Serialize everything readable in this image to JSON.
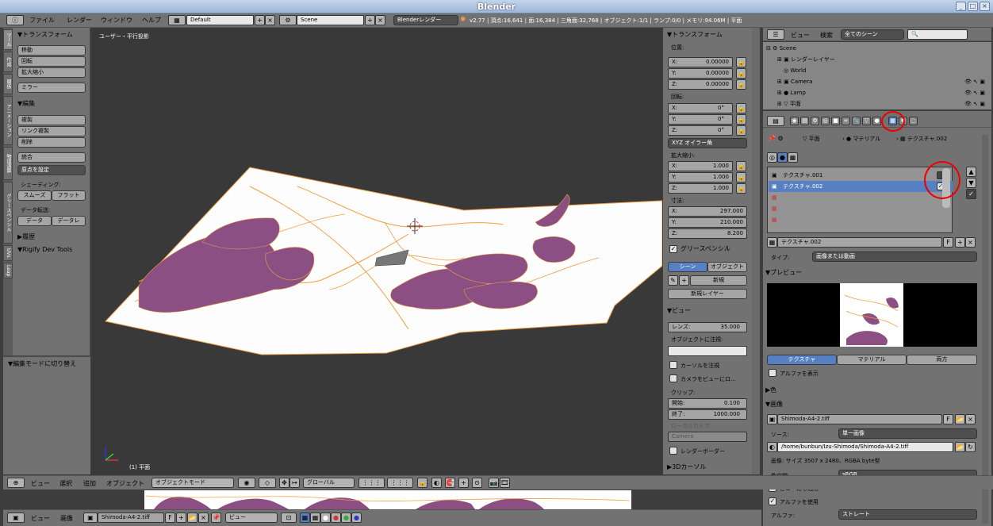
{
  "window": {
    "title": "Blender"
  },
  "topbar": {
    "menus": [
      "ファイル",
      "レンダー",
      "ウィンドウ",
      "ヘルプ"
    ],
    "layout": "Default",
    "scene": "Scene",
    "engine": "Blenderレンダー",
    "stats": "v2.77 | 頂点:16,641 | 面:16,384 | 三角面:32,768 | オブジェクト:1/1 | ランプ:0/0 | メモリ:94.06M | 平面"
  },
  "vtabs": [
    "ツール",
    "作成",
    "関係",
    "アニメーション",
    "物理演算",
    "グリースペンシル",
    "UVs",
    "Leap"
  ],
  "tool": {
    "transform_header": "▼トランスフォーム",
    "transform_buttons": [
      "移動",
      "回転",
      "拡大縮小"
    ],
    "mirror": "ミラー",
    "edit_header": "▼編集",
    "edit_buttons": [
      "複製",
      "リンク複製",
      "削除"
    ],
    "join": "統合",
    "set_origin": "原点を設定",
    "shading_label": "シェーディング:",
    "smooth": "スムーズ",
    "flat": "フラット",
    "data_transfer_label": "データ転送:",
    "data": "データ",
    "data_layout": "データレ",
    "history": "▶履歴",
    "rigify": "▼Rigify Dev Tools"
  },
  "operator_panel": {
    "title": "▼編集モードに切り替え"
  },
  "viewport": {
    "label": "ユーザー・平行投影",
    "object": "(1) 平面"
  },
  "npanel": {
    "transform_header": "▼トランスフォーム",
    "location_label": "位置:",
    "location": [
      "X:",
      "0.00000",
      "Y:",
      "0.00000",
      "Z:",
      "0.00000"
    ],
    "rotation_label": "回転:",
    "rotation": [
      "X:",
      "0°",
      "Y:",
      "0°",
      "Z:",
      "0°"
    ],
    "euler": "XYZ オイラー角",
    "scale_label": "拡大縮小:",
    "scale": [
      "X:",
      "1.000",
      "Y:",
      "1.000",
      "Z:",
      "1.000"
    ],
    "dimensions_label": "寸法:",
    "dimensions": [
      "X:",
      "297.000",
      "Y:",
      "210.000",
      "Z:",
      "8.200"
    ],
    "gp_header": "グリースペンシル",
    "scene_tab": "シーン",
    "object_tab": "オブジェクト",
    "new": "新規",
    "new_layer": "新規レイヤー",
    "view_header": "▼ビュー",
    "lens_label": "レンズ:",
    "lens_value": "35.000",
    "lock_to_object": "オブジェクトに注視:",
    "lock_cursor": "カーソルを注視",
    "camera_to_view": "カメラをビューにロ...",
    "clip_label": "クリップ:",
    "clip_start_label": "開始:",
    "clip_start": "0.100",
    "clip_end_label": "終了:",
    "clip_end": "1000.000",
    "local_camera": "ローカルカメラ:",
    "camera": "Camera",
    "render_border": "レンダーボーダー",
    "cursor_header": "▶3Dカーソル"
  },
  "outliner": {
    "view_menu": "ビュー",
    "search_menu": "検索",
    "filter": "全てのシーン",
    "rows": [
      "Scene",
      "レンダーレイヤー",
      "World",
      "Camera",
      "Lamp",
      "平面"
    ]
  },
  "props": {
    "breadcrumb": [
      "平面",
      "マテリアル",
      "テクスチャ.002"
    ],
    "slots": [
      "テクスチャ.001",
      "テクスチャ.002"
    ],
    "texture_name": "テクスチャ.002",
    "fake_user": "F",
    "type_label": "タイプ:",
    "type_value": "画像または動画",
    "preview_header": "▼プレビュー",
    "preview_tabs": [
      "テクスチャ",
      "マテリアル",
      "両方"
    ],
    "show_alpha": "アルファを表示",
    "color_header": "▶色",
    "image_header": "▼画像",
    "image_name": "Shimoda-A4-2.tiff",
    "source_label": "ソース:",
    "source_value": "単一画像",
    "filepath": "/home/bunbun/Izu-Shimoda/Shimoda-A4-2.tiff",
    "image_info": "画像: サイズ 3507 x 2480、RGBA byte型",
    "colorspace_label": "色空間:",
    "colorspace_value": "sRGB",
    "use_view": "ビューにも適用",
    "use_alpha": "アルファを使用",
    "alpha_label": "アルファ:",
    "alpha_value": "ストレート"
  },
  "bottom": {
    "menus": [
      "ビュー",
      "選択",
      "追加",
      "オブジェクト"
    ],
    "mode": "オブジェクトモード",
    "orientation": "グローバル",
    "image_menus": [
      "ビュー",
      "画像"
    ],
    "image_name": "Shimoda-A4-2.tiff",
    "image_view": "ビュー"
  },
  "colors": {
    "map_purple": "#8b4f84",
    "map_orange": "#f0a040",
    "selected": "#5680c2",
    "highlight_red": "#e00000"
  }
}
